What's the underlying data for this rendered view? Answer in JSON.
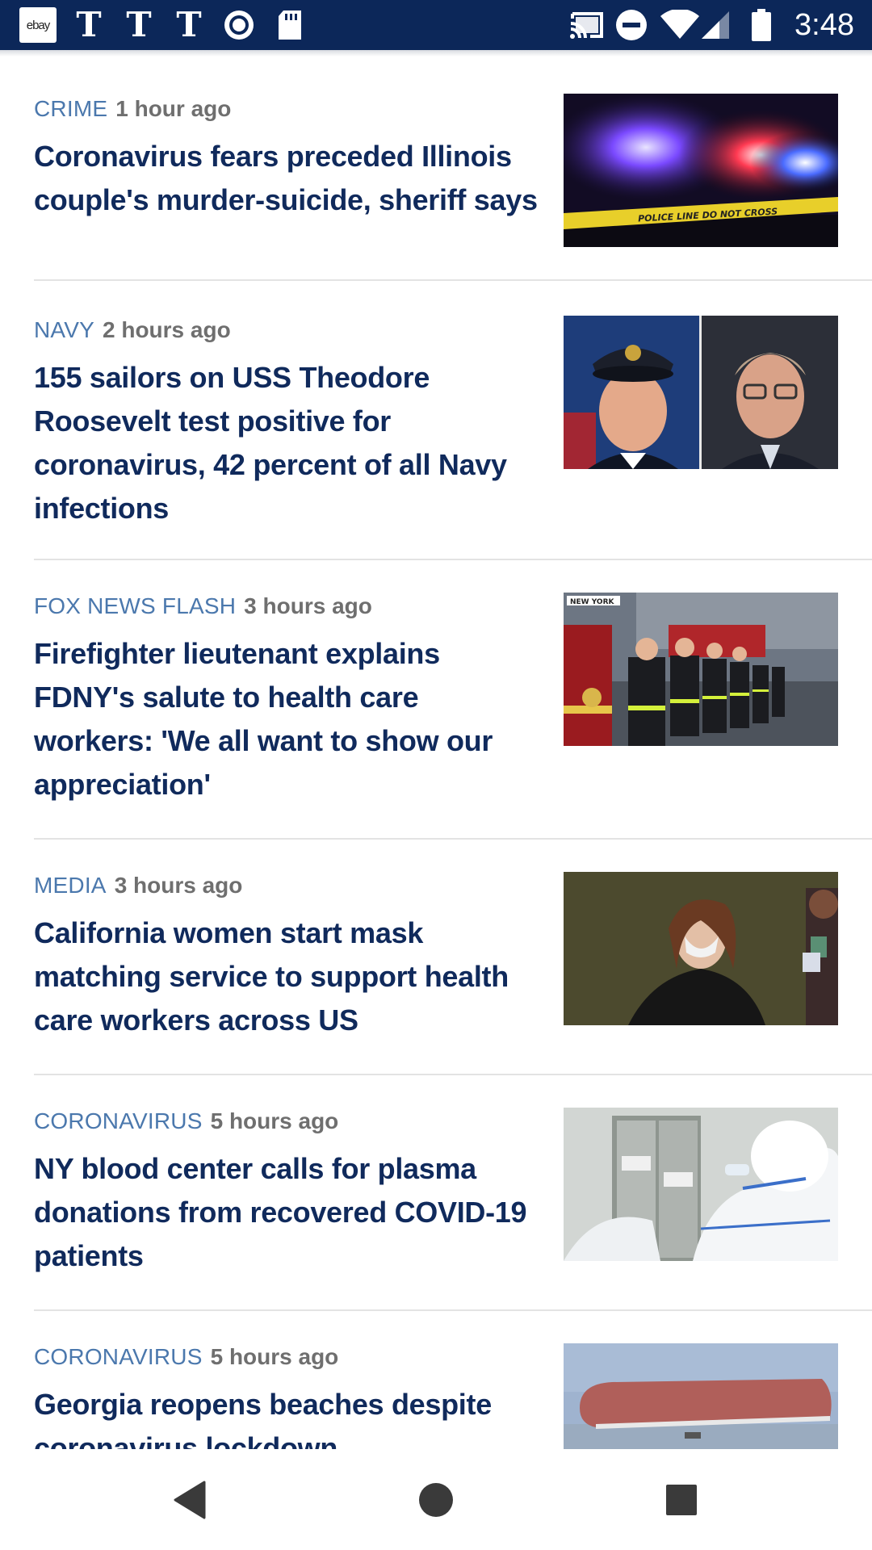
{
  "status_bar": {
    "time": "3:48",
    "left_icons": [
      "ebay-icon",
      "nyt-icon",
      "nyt-icon",
      "nyt-icon",
      "record-icon",
      "sd-card-icon"
    ],
    "ebay_label": "ebay",
    "nyt_glyph": "T",
    "right_icons": [
      "cast-icon",
      "do-not-disturb-icon",
      "wifi-icon",
      "signal-icon",
      "battery-icon"
    ]
  },
  "articles": [
    {
      "category": "CRIME",
      "time": "1 hour ago",
      "headline": "Coronavirus fears preceded Illinois couple's murder-suicide, sheriff says",
      "image_text": "POLICE LINE DO NOT CROSS"
    },
    {
      "category": "NAVY",
      "time": "2 hours ago",
      "headline": "155 sailors on USS Theodore Roosevelt test positive for coronavirus, 42 percent of all Navy infections"
    },
    {
      "category": "FOX NEWS FLASH",
      "time": "3 hours ago",
      "headline": "Firefighter lieutenant explains FDNY's salute to health care workers: 'We all want to show our appreciation'",
      "image_text": "NEW YORK"
    },
    {
      "category": "MEDIA",
      "time": "3 hours ago",
      "headline": "California women start mask matching service to support health care workers across US"
    },
    {
      "category": "CORONAVIRUS",
      "time": "5 hours ago",
      "headline": "NY blood center calls for plasma donations from recovered COVID-19 patients"
    },
    {
      "category": "CORONAVIRUS",
      "time": "5 hours ago",
      "headline": "Georgia reopens beaches despite coronavirus lockdown"
    }
  ],
  "nav_bar": {
    "buttons": [
      "back-icon",
      "home-icon",
      "recents-icon"
    ]
  },
  "colors": {
    "status_bar": "#0c2759",
    "category": "#4b78ad",
    "headline": "#102a5c",
    "time": "#6f6f6f"
  }
}
